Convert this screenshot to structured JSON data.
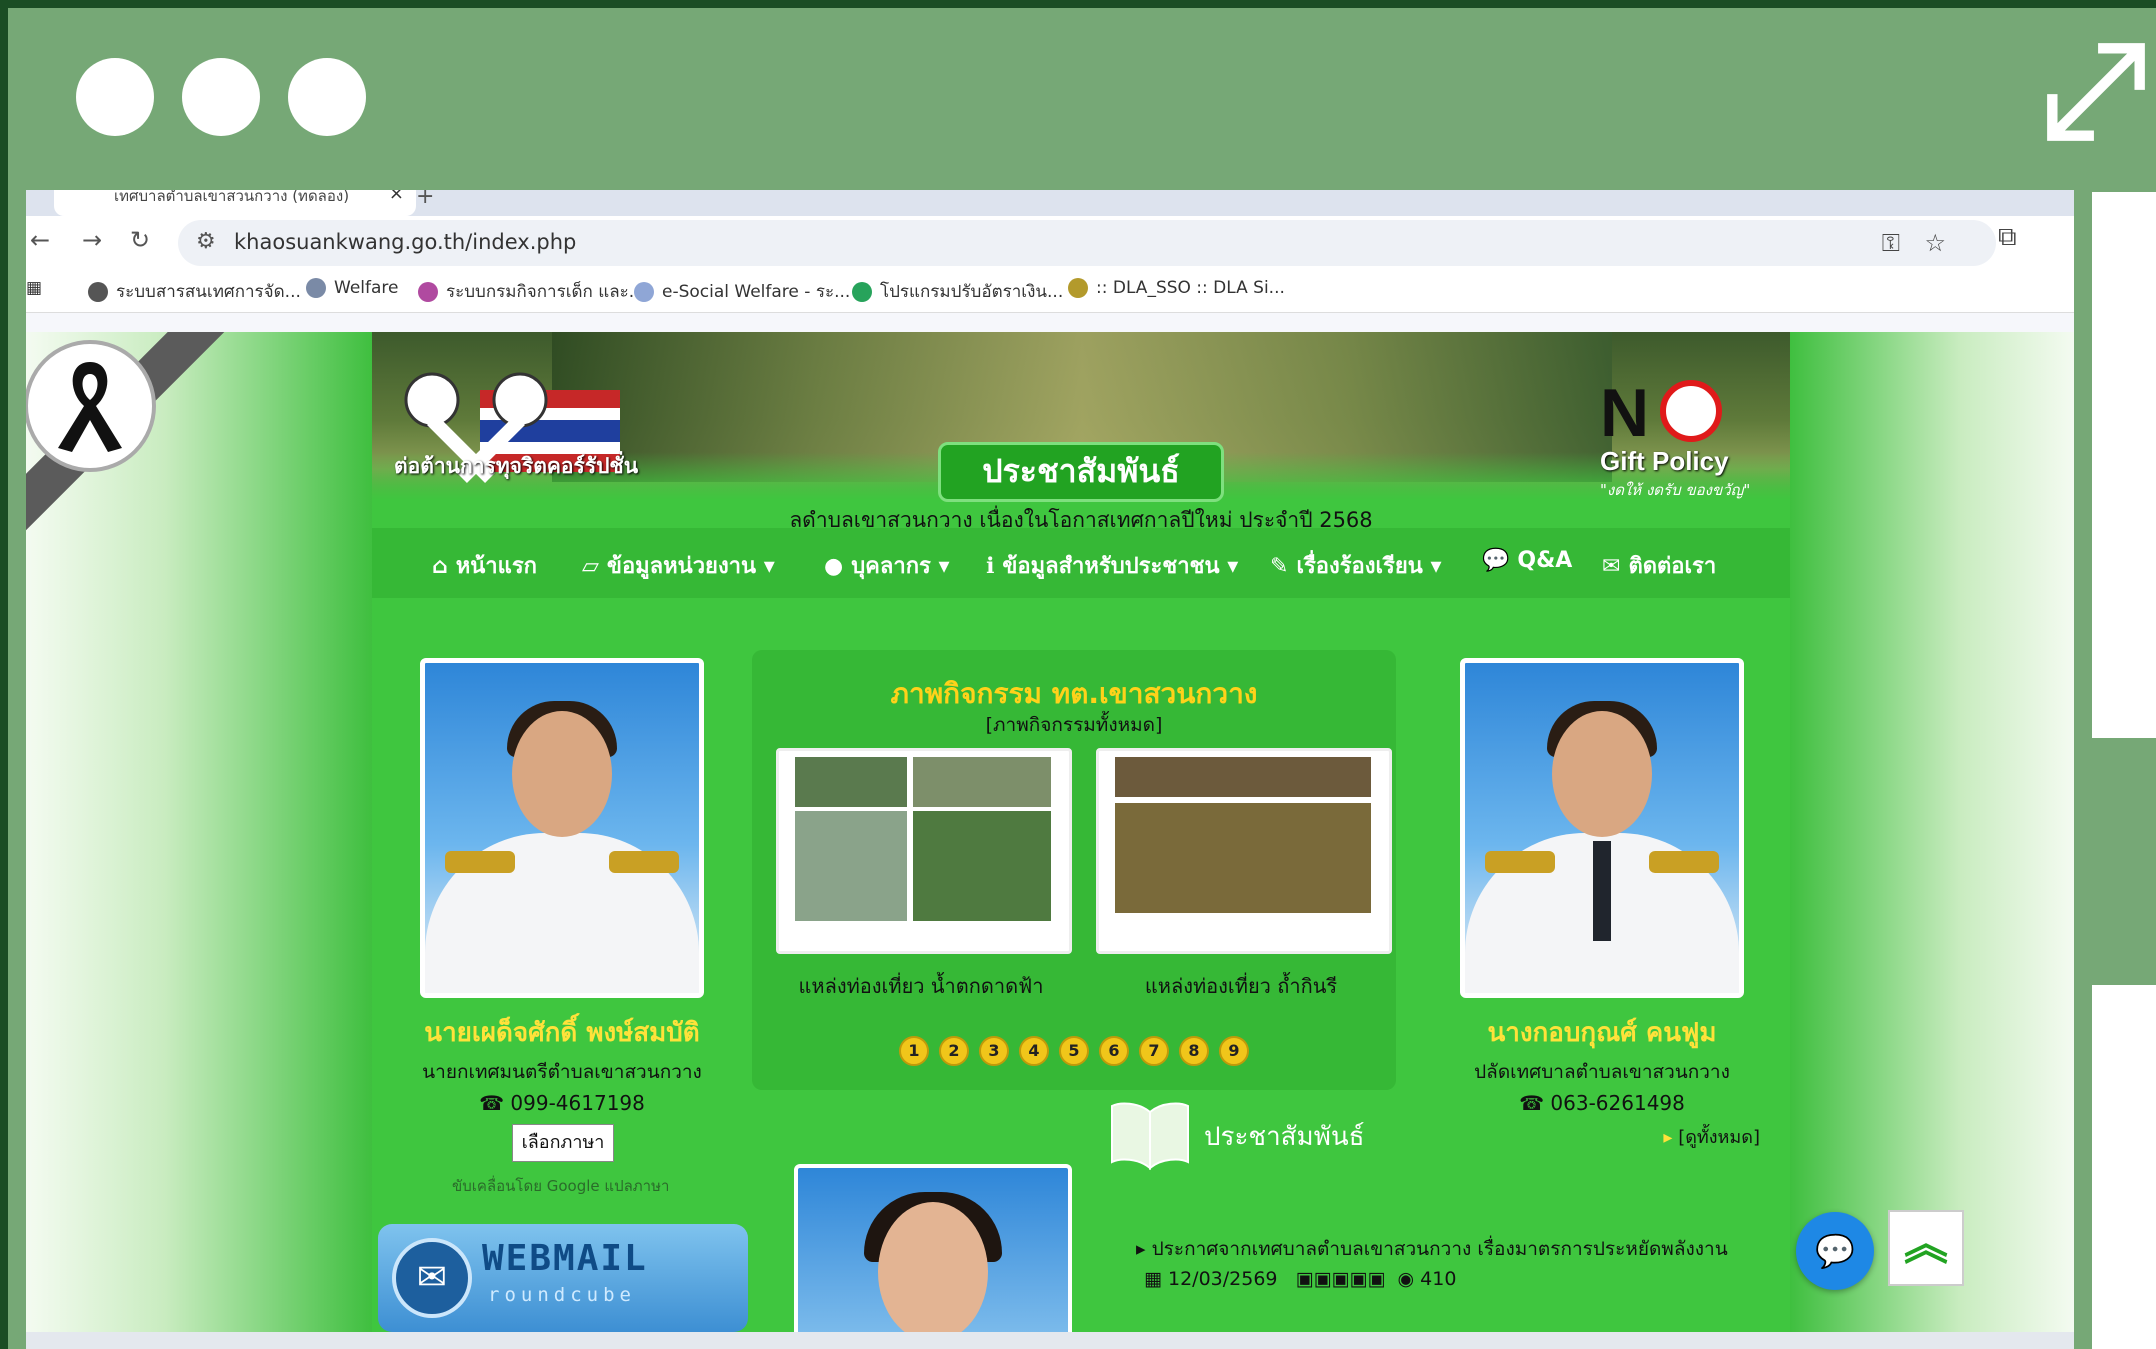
{
  "browser": {
    "tab_title": "เทศบาลตำบลเขาสวนกวาง (ทดลอง)",
    "url": "khaosuankwang.go.th/index.php",
    "bookmarks": [
      "ระบบสารสนเทศการจัด...",
      "Welfare",
      "ระบบกรมกิจการเด็ก และ...",
      "e-Social Welfare - ระ...",
      "โปรแกรมปรับอัตราเงิน...",
      ":: DLA_SSO :: DLA Si..."
    ]
  },
  "banner": {
    "anti_corruption": "ต่อต้านการทุจริตคอร์รัปชั่น",
    "pr_label": "ประชาสัมพันธ์",
    "subtitle": "ลดำบลเขาสวนกวาง เนื่องในโอกาสเทศกาลปีใหม่ ประจำปี 2568",
    "no_gift_no": "N",
    "no_gift_policy": "Gift Policy",
    "no_gift_sub": "\"งดให้ งดรับ ของขวัญ\""
  },
  "nav": {
    "home": "หน้าแรก",
    "agency_info": "ข้อมูลหน่วยงาน",
    "personnel": "บุคลากร",
    "public_info": "ข้อมูลสำหรับประชาชน",
    "complaints": "เรื่องร้องเรียน",
    "qa": "Q&A",
    "contact": "ติดต่อเรา"
  },
  "left_person": {
    "name": "นายเผด็จศักดิ์ พงษ์สมบัติ",
    "title": "นายกเทศมนตรีตำบลเขาสวนกวาง",
    "phone": "099-4617198"
  },
  "right_person": {
    "name": "นางกอบกุณศ์ คนฟูม",
    "title": "ปลัดเทศบาลตำบลเขาสวนกวาง",
    "phone": "063-6261498"
  },
  "gallery": {
    "title": "ภาพกิจกรรม ทต.เขาสวนกวาง",
    "all_link": "[ภาพกิจกรรมทั้งหมด]",
    "items": [
      {
        "caption": "แหล่งท่องเที่ยว น้ำตกดาดฟ้า"
      },
      {
        "caption": "แหล่งท่องเที่ยว ถ้ำกินรี"
      }
    ],
    "pages": [
      "1",
      "2",
      "3",
      "4",
      "5",
      "6",
      "7",
      "8",
      "9"
    ]
  },
  "language": {
    "button": "เลือกภาษา",
    "powered_by": "ขับเคลื่อนโดย Google แปลภาษา"
  },
  "webmail": {
    "label": "WEBMAIL",
    "sub": "roundcube"
  },
  "news": {
    "title": "ประชาสัมพันธ์",
    "all_link": "[ดูทั้งหมด]",
    "item_title": "ประกาศจากเทศบาลตำบลเขาสวนกวาง เรื่องมาตรการประหยัดพลังงาน",
    "item_date": "12/03/2569",
    "item_views": "410"
  },
  "colors": {
    "frame_bg": "#76a876",
    "frame_border": "#1a4d24",
    "site_green": "#3fc63f",
    "nav_green": "#36b836",
    "accent_yellow": "#ffe23a"
  }
}
